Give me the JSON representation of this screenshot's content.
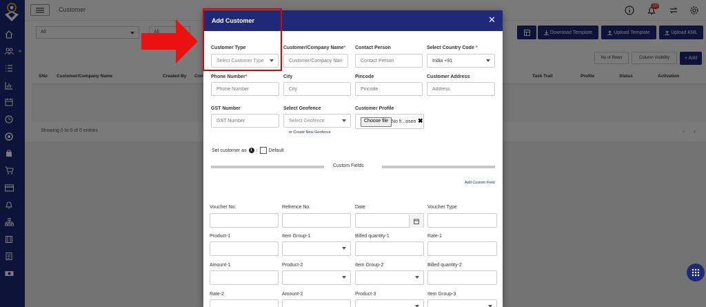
{
  "header": {
    "page_title": "Customer",
    "notification_count": "120"
  },
  "filters": {
    "filter1": "All",
    "filter2": "All"
  },
  "toolbar": {
    "download_template": "Download Template",
    "upload_template": "Upload Template",
    "upload_kml": "Upload KML"
  },
  "table_controls": {
    "rows": "No of Rows",
    "visibility": "Column Visibility",
    "add": "+ Add"
  },
  "table": {
    "headers_left": [
      "SNo",
      "Customer/Company Name",
      "Created By",
      "Cont"
    ],
    "headers_right": [
      "Task Trail",
      "Profile",
      "Status",
      "Activation"
    ],
    "footer": "Showing 0 to 0 of 0 entries"
  },
  "modal": {
    "title": "Add Customer",
    "customer_type": {
      "label": "Customer Type",
      "placeholder": "Select Customer Type"
    },
    "company_name": {
      "label": "Customer/Company Name",
      "placeholder": "Customer/Company Name"
    },
    "contact_person": {
      "label": "Contact Person",
      "placeholder": "Contact Person"
    },
    "country_code": {
      "label": "Select Country Code",
      "value": "India +91"
    },
    "phone": {
      "label": "Phone Number",
      "placeholder": "Phone Number"
    },
    "city": {
      "label": "City",
      "placeholder": "City"
    },
    "pincode": {
      "label": "Pincode",
      "placeholder": "Pincode"
    },
    "address": {
      "label": "Customer Address",
      "placeholder": "Address"
    },
    "gst": {
      "label": "GST Number",
      "placeholder": "GST Number"
    },
    "geofence": {
      "label": "Select Geofence",
      "placeholder": "Select Geofence",
      "link": "or Create New Geofence"
    },
    "profile": {
      "label": "Customer Profile",
      "button": "Choose file",
      "status": "No fi...osen"
    },
    "set_as": {
      "label": "Set customer as",
      "colon": ":",
      "default": "Default"
    },
    "custom_fields": {
      "title": "Custom Fields",
      "add_link": "Add Custom Field"
    },
    "grid_labels": [
      "Voucher No.",
      "Refrence No.",
      "Date",
      "Voucher Type",
      "Product-1",
      "Item Group-1",
      "Billed quantity-1",
      "Rate-1",
      "Amount-1",
      "Product-2",
      "Item Group-2",
      "Billed quantity-2",
      "Rate-2",
      "Amount-2",
      "Product-3",
      "Item Group-3"
    ]
  },
  "colors": {
    "navy": "#1e2a78",
    "annotation_red": "#e50000"
  }
}
